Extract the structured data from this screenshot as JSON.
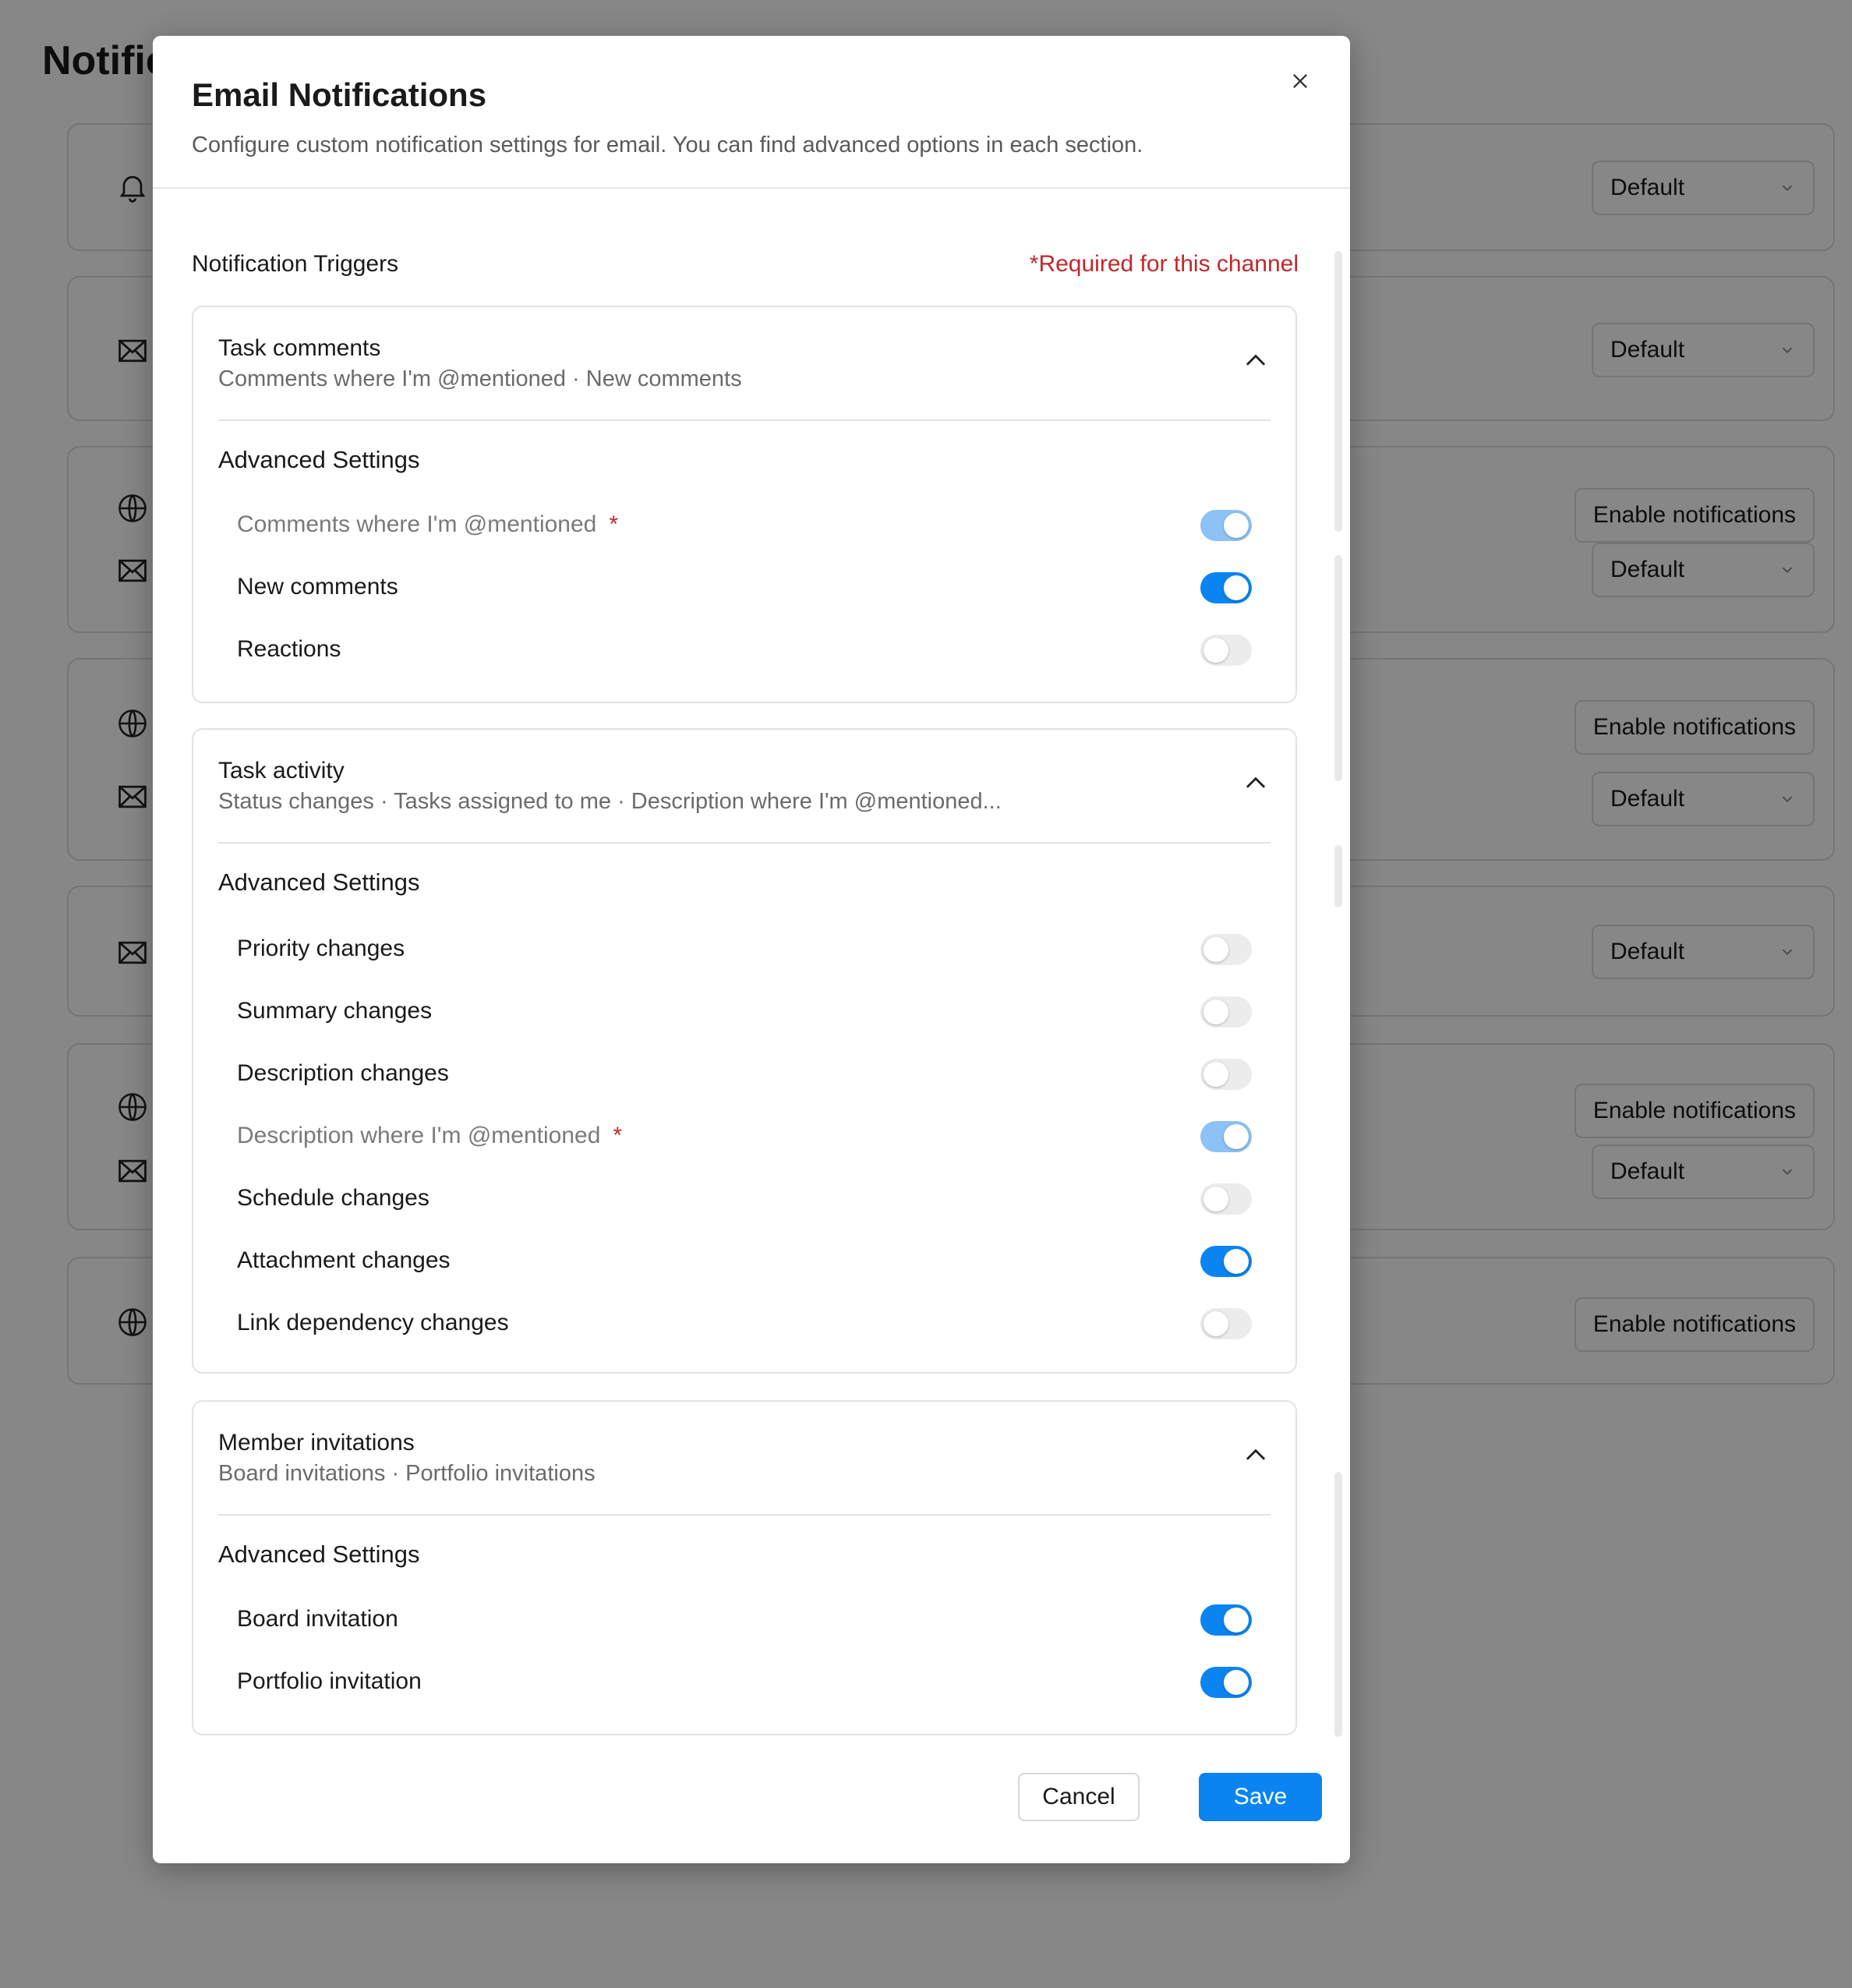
{
  "background": {
    "page_title": "Notific",
    "cards": [
      {
        "icons": [
          "bell-icon"
        ],
        "buttons": [
          {
            "type": "select",
            "label": "Default"
          }
        ]
      },
      {
        "icons": [
          "mail-icon"
        ],
        "buttons": [
          {
            "type": "select",
            "label": "Default"
          }
        ]
      },
      {
        "icons": [
          "globe-icon",
          "mail-icon"
        ],
        "buttons": [
          {
            "type": "enable",
            "label": "Enable notifications"
          },
          {
            "type": "select",
            "label": "Default"
          }
        ]
      },
      {
        "icons": [
          "globe-icon",
          "mail-icon"
        ],
        "buttons": [
          {
            "type": "enable",
            "label": "Enable notifications"
          },
          {
            "type": "select",
            "label": "Default"
          }
        ]
      },
      {
        "icons": [
          "mail-icon"
        ],
        "buttons": [
          {
            "type": "select",
            "label": "Default"
          }
        ]
      },
      {
        "icons": [
          "globe-icon",
          "mail-icon"
        ],
        "buttons": [
          {
            "type": "enable",
            "label": "Enable notifications"
          },
          {
            "type": "select",
            "label": "Default"
          }
        ]
      },
      {
        "icons": [
          "globe-icon"
        ],
        "buttons": [
          {
            "type": "enable",
            "label": "Enable notifications"
          }
        ]
      }
    ]
  },
  "modal": {
    "title": "Email Notifications",
    "description": "Configure custom notification settings for email. You can find advanced options in each section.",
    "triggers_label": "Notification Triggers",
    "required_note": "*Required for this channel",
    "sections": [
      {
        "title": "Task comments",
        "summary": "Comments where I'm @mentioned · New comments",
        "advanced_title": "Advanced Settings",
        "settings": [
          {
            "label": "Comments where I'm @mentioned",
            "required": true,
            "on": true
          },
          {
            "label": "New comments",
            "required": false,
            "on": true
          },
          {
            "label": "Reactions",
            "required": false,
            "on": false
          }
        ]
      },
      {
        "title": "Task activity",
        "summary": "Status changes · Tasks assigned to me · Description where I'm @mentioned...",
        "advanced_title": "Advanced Settings",
        "settings": [
          {
            "label": "Priority changes",
            "required": false,
            "on": false
          },
          {
            "label": "Summary changes",
            "required": false,
            "on": false
          },
          {
            "label": "Description changes",
            "required": false,
            "on": false
          },
          {
            "label": "Description where I'm @mentioned",
            "required": true,
            "on": true
          },
          {
            "label": "Schedule changes",
            "required": false,
            "on": false
          },
          {
            "label": "Attachment changes",
            "required": false,
            "on": true
          },
          {
            "label": "Link dependency changes",
            "required": false,
            "on": false
          }
        ]
      },
      {
        "title": "Member invitations",
        "summary": "Board invitations · Portfolio invitations",
        "advanced_title": "Advanced Settings",
        "settings": [
          {
            "label": "Board invitation",
            "required": false,
            "on": true
          },
          {
            "label": "Portfolio invitation",
            "required": false,
            "on": true
          }
        ]
      }
    ],
    "required_star": "*",
    "cancel_label": "Cancel",
    "save_label": "Save"
  }
}
